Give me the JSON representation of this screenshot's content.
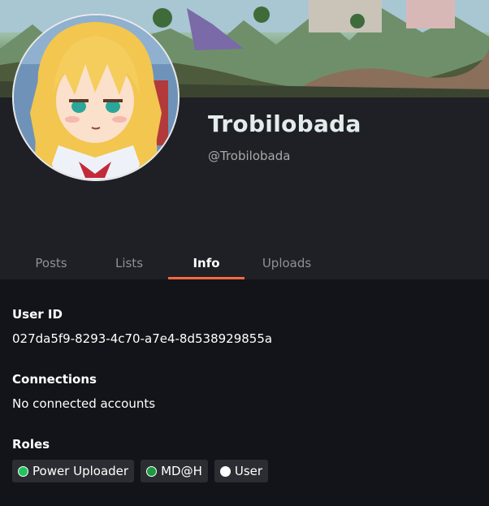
{
  "profile": {
    "display_name": "Trobilobada",
    "handle": "@Trobilobada"
  },
  "tabs": [
    {
      "label": "Posts",
      "active": false
    },
    {
      "label": "Lists",
      "active": false
    },
    {
      "label": "Info",
      "active": true
    },
    {
      "label": "Uploads",
      "active": false
    }
  ],
  "info": {
    "user_id_label": "User ID",
    "user_id_value": "027da5f9-8293-4c70-a7e4-8d538929855a",
    "connections_label": "Connections",
    "connections_value": "No connected accounts",
    "roles_label": "Roles",
    "roles": [
      {
        "label": "Power Uploader",
        "color": "#21c55d"
      },
      {
        "label": "MD@H",
        "color": "#1d9a3f"
      },
      {
        "label": "User",
        "color": "#ffffff"
      }
    ]
  },
  "colors": {
    "accent": "#ff6740",
    "background": "#131419",
    "panel": "#1f2025"
  }
}
